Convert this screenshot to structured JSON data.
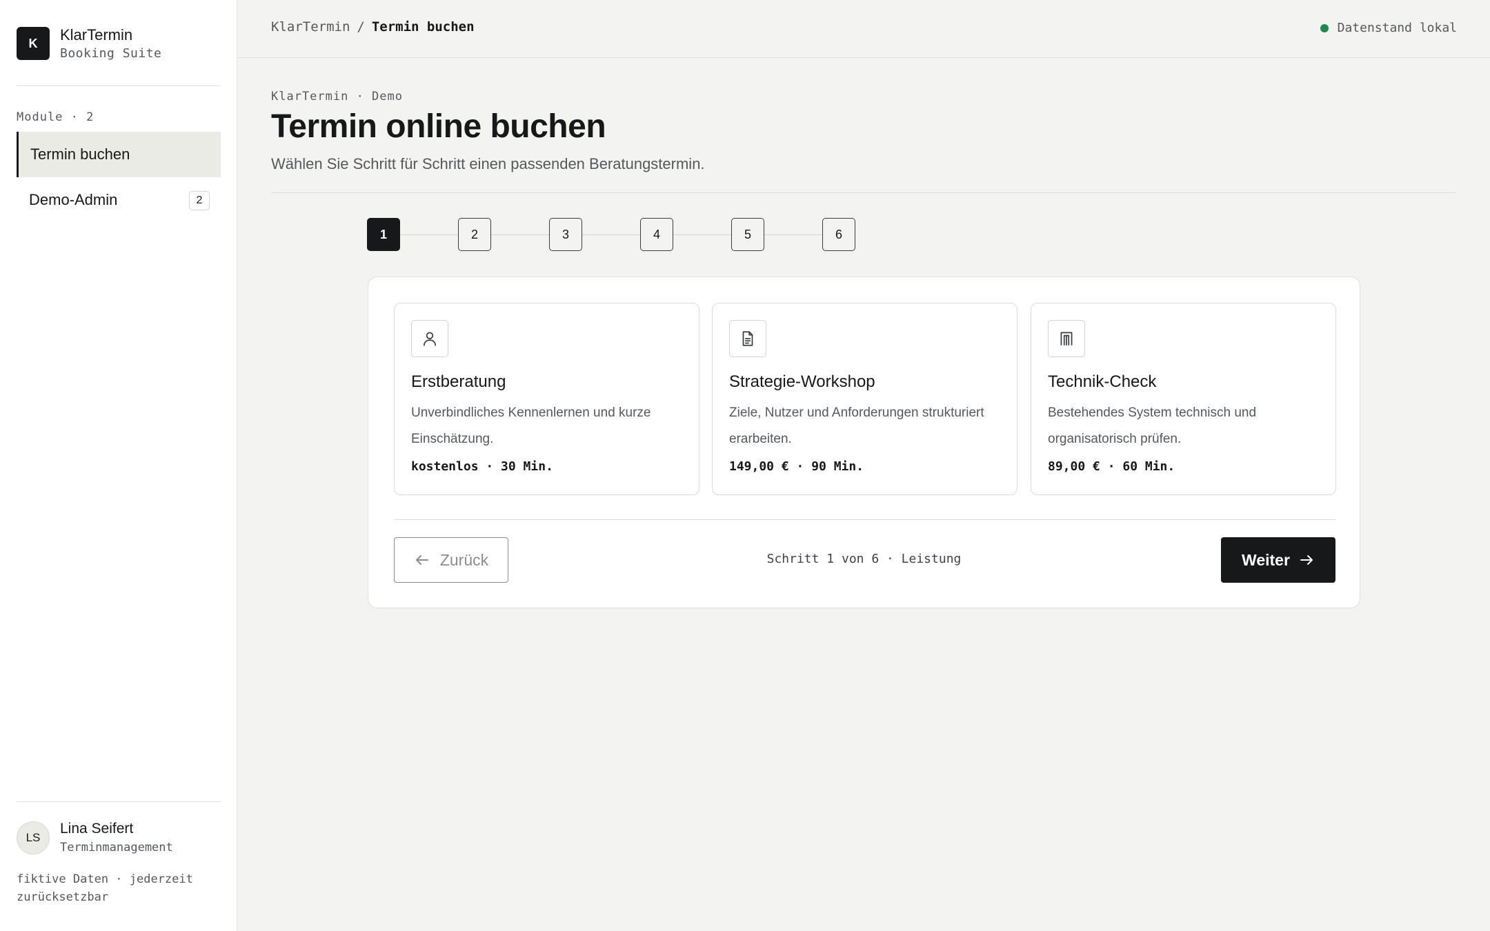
{
  "brand": {
    "logo_letter": "K",
    "name": "KlarTermin",
    "subtitle": "Booking Suite"
  },
  "sidebar": {
    "module_label": "Module · 2",
    "items": [
      {
        "label": "Termin buchen",
        "active": true
      },
      {
        "label": "Demo-Admin",
        "badge": "2",
        "active": false
      }
    ]
  },
  "user": {
    "initials": "LS",
    "name": "Lina Seifert",
    "role": "Terminmanagement"
  },
  "footnote": "fiktive Daten · jederzeit zurücksetzbar",
  "topbar": {
    "breadcrumb_root": "KlarTermin",
    "breadcrumb_sep": "/",
    "breadcrumb_current": "Termin buchen",
    "status": "Datenstand lokal",
    "status_color": "#1f8a4c"
  },
  "page": {
    "eyebrow": "KlarTermin · Demo",
    "title": "Termin online buchen",
    "subtitle": "Wählen Sie Schritt für Schritt einen passenden Beratungstermin."
  },
  "stepper": {
    "steps": [
      "1",
      "2",
      "3",
      "4",
      "5",
      "6"
    ],
    "active": 1
  },
  "services": [
    {
      "icon": "person-icon",
      "title": "Erstberatung",
      "description": "Unverbindliches Kennenlernen und kurze Einschätzung.",
      "meta": "kostenlos · 30 Min."
    },
    {
      "icon": "document-icon",
      "title": "Strategie-Workshop",
      "description": "Ziele, Nutzer und Anforderungen strukturiert erarbeiten.",
      "meta": "149,00 € · 90 Min."
    },
    {
      "icon": "building-icon",
      "title": "Technik-Check",
      "description": "Bestehendes System technisch und organisatorisch prüfen.",
      "meta": "89,00 € · 60 Min."
    }
  ],
  "footer": {
    "back_label": "Zurück",
    "step_info": "Schritt 1 von 6 · Leistung",
    "next_label": "Weiter"
  },
  "colors": {
    "accent": "#16181a",
    "background": "#f3f3f1"
  }
}
